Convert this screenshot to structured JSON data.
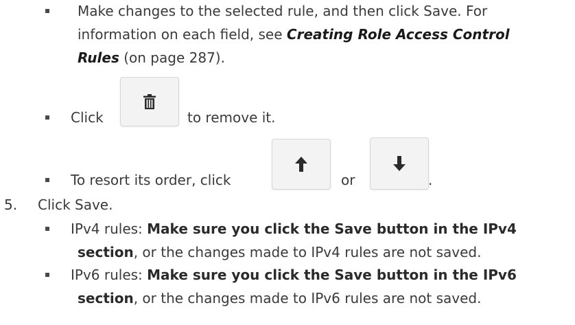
{
  "bullets": {
    "edit": {
      "line1": "Make changes to the selected rule, and then click Save. For",
      "line2_pre": "information on each field, see ",
      "line2_link": "Creating Role Access Control",
      "line3_link": "Rules",
      "line3_post": " (on page 287)."
    },
    "delete": {
      "pre": "Click",
      "post": "to remove it."
    },
    "resort": {
      "pre": "To resort its order, click",
      "mid": "or",
      "post": "."
    }
  },
  "step5": {
    "number": "5.",
    "text": "Click Save.",
    "ipv4": {
      "label": "IPv4 rules: ",
      "bold_line1": "Make sure you click the Save button in the IPv4",
      "bold_line2": "section",
      "rest_line2": ", or the changes made to IPv4 rules are not saved."
    },
    "ipv6": {
      "label": "IPv6 rules: ",
      "bold_line1": "Make sure you click the Save button in the IPv6",
      "bold_line2": "section",
      "rest_line2": ", or the changes made to IPv6 rules are not saved."
    }
  },
  "icons": {
    "delete": "trash-icon",
    "up": "arrow-up-icon",
    "down": "arrow-down-icon"
  }
}
